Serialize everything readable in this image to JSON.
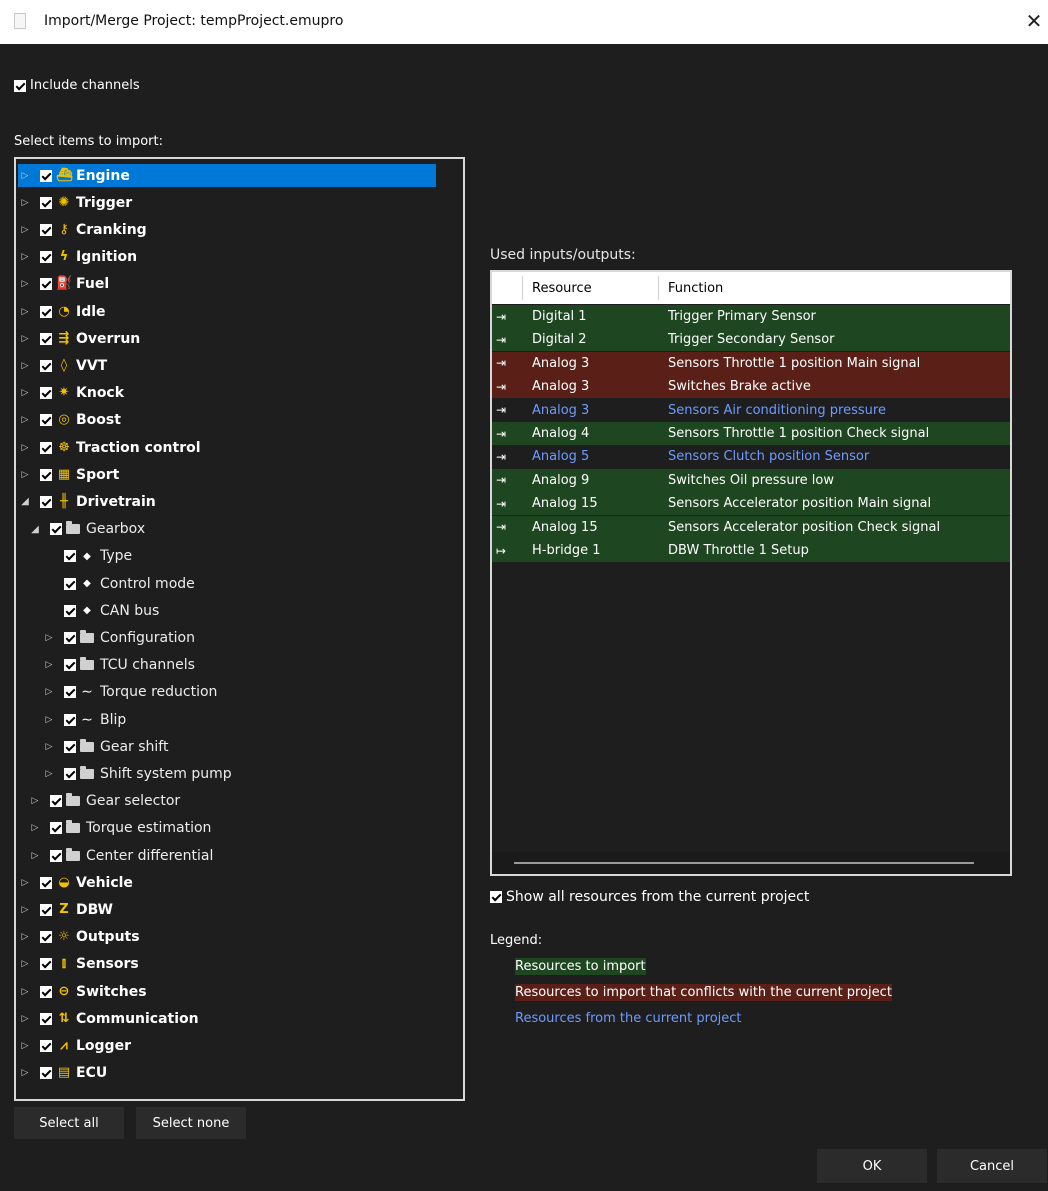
{
  "window": {
    "title": "Import/Merge Project: tempProject.emupro"
  },
  "include_channels": {
    "label": "Include channels",
    "checked": true
  },
  "select_items_label": "Select items to import:",
  "tree": {
    "items": [
      {
        "label": "Engine",
        "icon": "engine-icon",
        "glyph": "⛴",
        "level": 0,
        "expander": "collapsed",
        "selected": true,
        "bold": true
      },
      {
        "label": "Trigger",
        "icon": "gear-icon",
        "glyph": "✺",
        "level": 0,
        "expander": "collapsed",
        "bold": true
      },
      {
        "label": "Cranking",
        "icon": "wrench-icon",
        "glyph": "⚷",
        "level": 0,
        "expander": "collapsed",
        "bold": true
      },
      {
        "label": "Ignition",
        "icon": "lightning-icon",
        "glyph": "ϟ",
        "level": 0,
        "expander": "collapsed",
        "bold": true
      },
      {
        "label": "Fuel",
        "icon": "fuel-icon",
        "glyph": "⛽",
        "level": 0,
        "expander": "collapsed",
        "bold": true
      },
      {
        "label": "Idle",
        "icon": "idle-gauge-icon",
        "glyph": "◔",
        "level": 0,
        "expander": "collapsed",
        "bold": true
      },
      {
        "label": "Overrun",
        "icon": "overrun-icon",
        "glyph": "⇶",
        "level": 0,
        "expander": "collapsed",
        "bold": true
      },
      {
        "label": "VVT",
        "icon": "drop-icon",
        "glyph": "◊",
        "level": 0,
        "expander": "collapsed",
        "bold": true
      },
      {
        "label": "Knock",
        "icon": "knock-icon",
        "glyph": "✷",
        "level": 0,
        "expander": "collapsed",
        "bold": true
      },
      {
        "label": "Boost",
        "icon": "turbo-icon",
        "glyph": "◎",
        "level": 0,
        "expander": "collapsed",
        "bold": true
      },
      {
        "label": "Traction control",
        "icon": "traction-icon",
        "glyph": "☸",
        "level": 0,
        "expander": "collapsed",
        "bold": true
      },
      {
        "label": "Sport",
        "icon": "checkered-flag-icon",
        "glyph": "▦",
        "level": 0,
        "expander": "collapsed",
        "bold": true
      },
      {
        "label": "Drivetrain",
        "icon": "drivetrain-icon",
        "glyph": "╫",
        "level": 0,
        "expander": "expanded",
        "bold": true
      },
      {
        "label": "Gearbox",
        "icon": "folder-icon",
        "level": 1,
        "expander": "expanded"
      },
      {
        "label": "Type",
        "icon": "diamond-icon",
        "level": 2,
        "expander": "none"
      },
      {
        "label": "Control mode",
        "icon": "diamond-icon",
        "level": 2,
        "expander": "none"
      },
      {
        "label": "CAN bus",
        "icon": "diamond-icon",
        "level": 2,
        "expander": "none"
      },
      {
        "label": "Configuration",
        "icon": "folder-icon",
        "level": 2,
        "expander": "collapsed"
      },
      {
        "label": "TCU channels",
        "icon": "folder-icon",
        "level": 2,
        "expander": "collapsed"
      },
      {
        "label": "Torque reduction",
        "icon": "wave-icon",
        "level": 2,
        "expander": "collapsed"
      },
      {
        "label": "Blip",
        "icon": "wave-icon",
        "level": 2,
        "expander": "collapsed"
      },
      {
        "label": "Gear shift",
        "icon": "folder-icon",
        "level": 2,
        "expander": "collapsed"
      },
      {
        "label": "Shift system pump",
        "icon": "folder-icon",
        "level": 2,
        "expander": "collapsed"
      },
      {
        "label": "Gear selector",
        "icon": "folder-icon",
        "level": 1,
        "expander": "collapsed"
      },
      {
        "label": "Torque estimation",
        "icon": "folder-icon",
        "level": 1,
        "expander": "collapsed"
      },
      {
        "label": "Center differential",
        "icon": "folder-icon",
        "level": 1,
        "expander": "collapsed"
      },
      {
        "label": "Vehicle",
        "icon": "car-icon",
        "glyph": "◒",
        "level": 0,
        "expander": "collapsed",
        "bold": true
      },
      {
        "label": "DBW",
        "icon": "dbw-icon",
        "glyph": "Z",
        "level": 0,
        "expander": "collapsed",
        "bold": true
      },
      {
        "label": "Outputs",
        "icon": "bulb-icon",
        "glyph": "☼",
        "level": 0,
        "expander": "collapsed",
        "bold": true
      },
      {
        "label": "Sensors",
        "icon": "thermometer-icon",
        "glyph": "⫾",
        "level": 0,
        "expander": "collapsed",
        "bold": true
      },
      {
        "label": "Switches",
        "icon": "toggle-icon",
        "glyph": "⊖",
        "level": 0,
        "expander": "collapsed",
        "bold": true
      },
      {
        "label": "Communication",
        "icon": "communication-icon",
        "glyph": "⇅",
        "level": 0,
        "expander": "collapsed",
        "bold": true
      },
      {
        "label": "Logger",
        "icon": "logger-icon",
        "glyph": "⩘",
        "level": 0,
        "expander": "collapsed",
        "bold": true
      },
      {
        "label": "ECU",
        "icon": "ecu-chip-icon",
        "glyph": "▤",
        "level": 0,
        "expander": "collapsed",
        "bold": true
      }
    ]
  },
  "buttons": {
    "select_all": "Select all",
    "select_none": "Select none",
    "ok": "OK",
    "cancel": "Cancel"
  },
  "used_io": {
    "label": "Used inputs/outputs:",
    "columns": {
      "resource": "Resource",
      "function": "Function"
    },
    "rows": [
      {
        "resource": "Digital 1",
        "function": "Trigger Primary Sensor",
        "status": "import",
        "io": "input"
      },
      {
        "resource": "Digital 2",
        "function": "Trigger Secondary Sensor",
        "status": "import",
        "io": "input"
      },
      {
        "resource": "Analog 3",
        "function": "Sensors Throttle 1 position Main signal",
        "status": "conflict",
        "io": "input"
      },
      {
        "resource": "Analog 3",
        "function": "Switches Brake active",
        "status": "conflict",
        "io": "input"
      },
      {
        "resource": "Analog 3",
        "function": "Sensors Air conditioning pressure",
        "status": "current",
        "io": "input"
      },
      {
        "resource": "Analog 4",
        "function": "Sensors Throttle 1 position Check signal",
        "status": "import",
        "io": "input"
      },
      {
        "resource": "Analog 5",
        "function": "Sensors Clutch position Sensor",
        "status": "current",
        "io": "input"
      },
      {
        "resource": "Analog 9",
        "function": "Switches Oil pressure low",
        "status": "import",
        "io": "input"
      },
      {
        "resource": "Analog 15",
        "function": "Sensors Accelerator position Main signal",
        "status": "import",
        "io": "input"
      },
      {
        "resource": "Analog 15",
        "function": "Sensors Accelerator position Check signal",
        "status": "import",
        "io": "input"
      },
      {
        "resource": "H-bridge 1",
        "function": "DBW Throttle 1 Setup",
        "status": "import",
        "io": "output"
      }
    ]
  },
  "show_all": {
    "label": "Show all resources from the current project",
    "checked": true
  },
  "legend": {
    "label": "Legend:",
    "items": [
      {
        "text": "Resources to import",
        "status": "import"
      },
      {
        "text": "Resources to import that conflicts with the current project",
        "status": "conflict"
      },
      {
        "text": "Resources from the current project",
        "status": "current"
      }
    ]
  },
  "colors": {
    "import_bg": "#1e4620",
    "conflict_bg": "#5a2018",
    "current_text": "#6e9bff",
    "selection": "#0078d7",
    "icon_accent": "#f2c200"
  }
}
